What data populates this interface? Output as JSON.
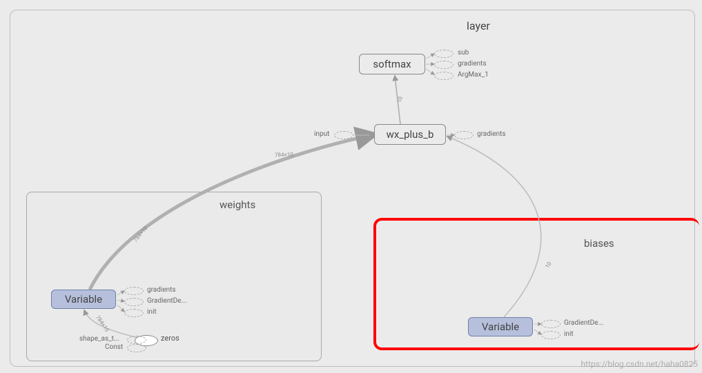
{
  "layer": {
    "title": "layer"
  },
  "weights": {
    "title": "weights"
  },
  "biases": {
    "title": "biases"
  },
  "softmax": {
    "label": "softmax"
  },
  "wx_plus_b": {
    "label": "wx_plus_b"
  },
  "variable1": {
    "label": "Variable"
  },
  "variable2": {
    "label": "Variable"
  },
  "zeros": {
    "label": "zeros"
  },
  "ext": {
    "sub": "sub",
    "gradients": "gradients",
    "argmax": "ArgMax_1",
    "input": "input",
    "gradient_de": "GradientDe...",
    "init": "init",
    "shape_as_t": "shape_as_t...",
    "const": "Const"
  },
  "edge_labels": {
    "e_784x10_w": "784×10",
    "e_784x10_main": "784×10",
    "e_10_bias": "10",
    "e_10_soft": "10",
    "e_784x10_z": "784×10"
  },
  "watermark": "https://blog.csdn.net/haha0825"
}
